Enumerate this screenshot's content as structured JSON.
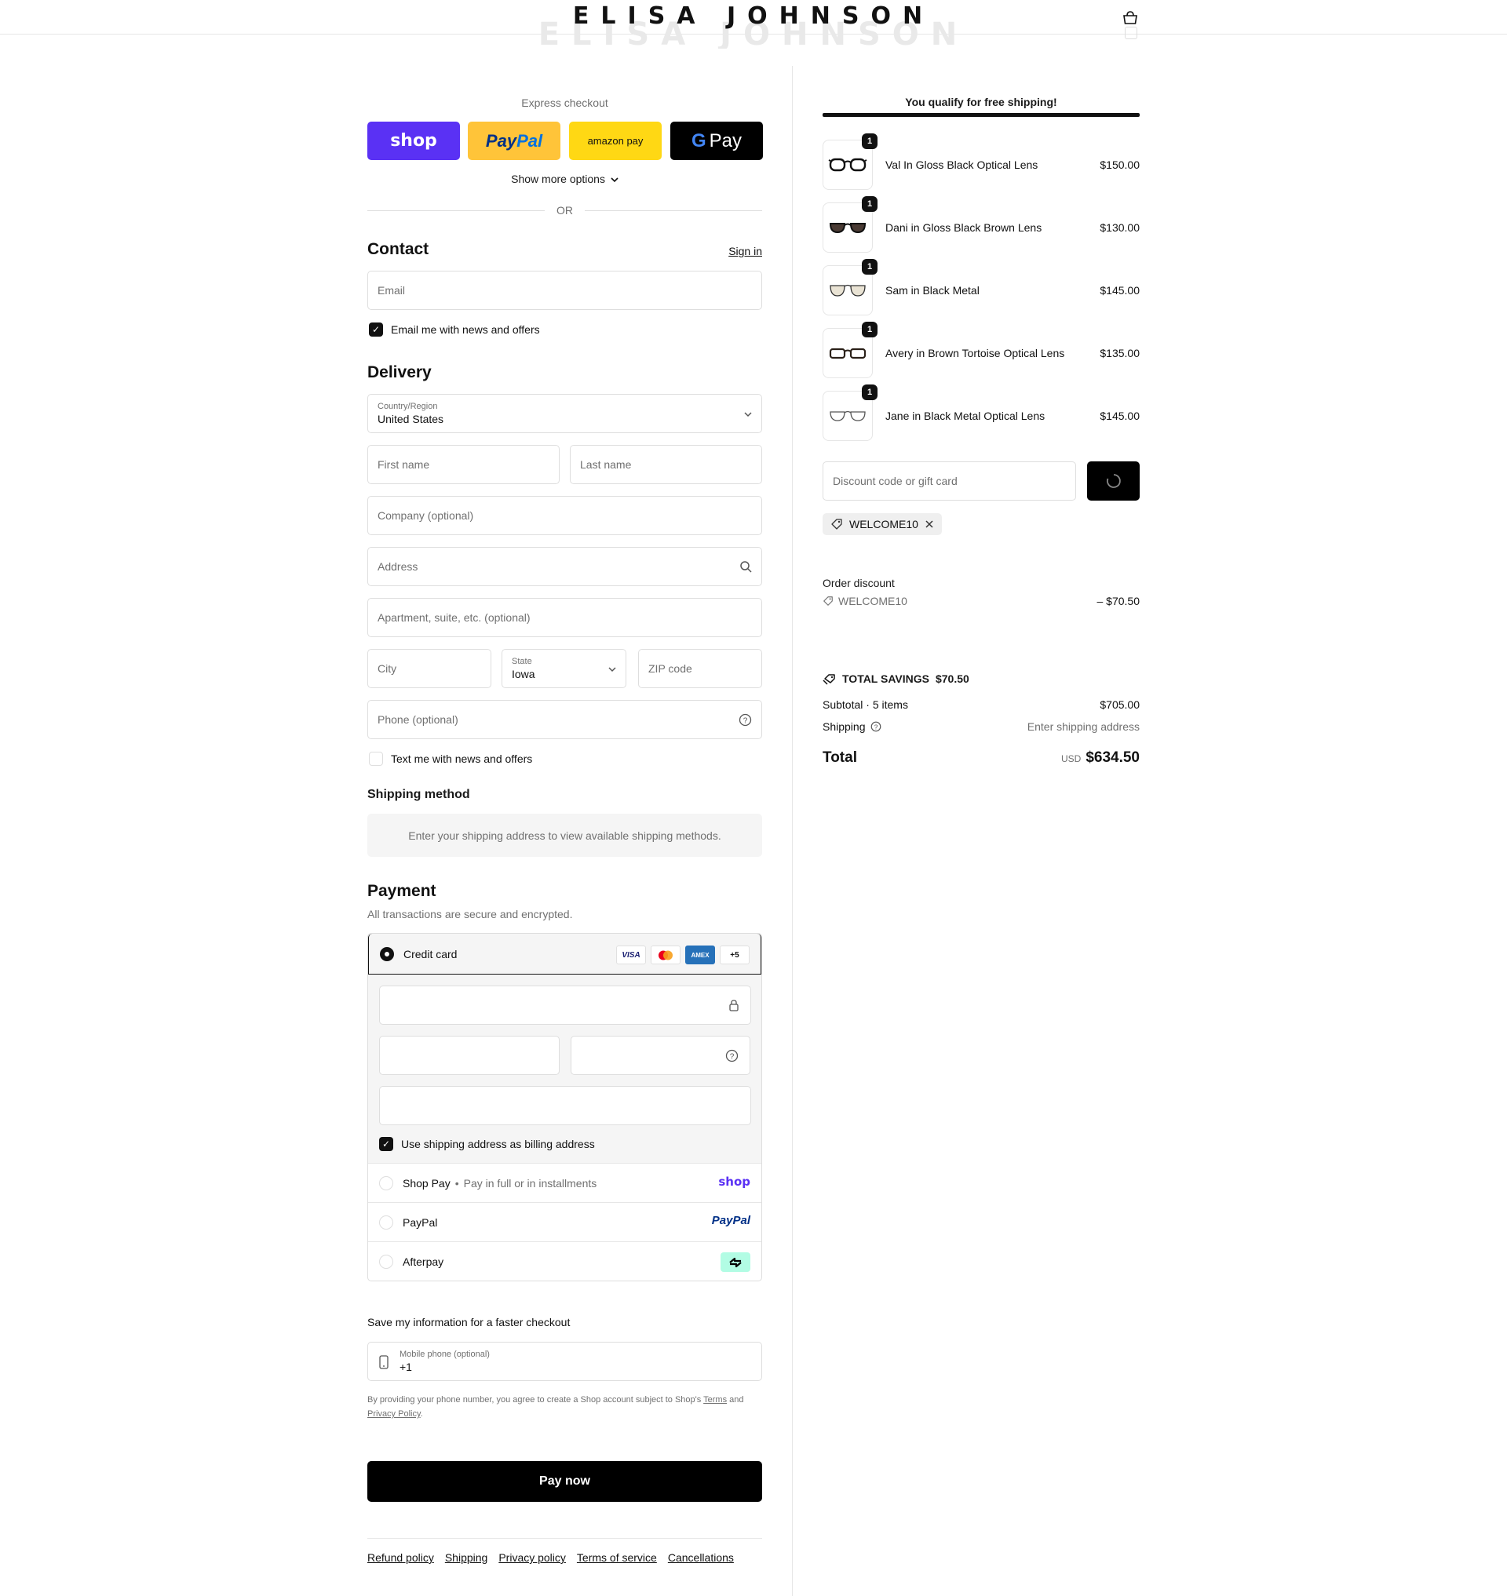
{
  "header": {
    "logo": "ELISA JOHNSON"
  },
  "express": {
    "label": "Express checkout",
    "shop_label": "shop",
    "paypal_pay": "Pay",
    "paypal_pal": "Pal",
    "amazon_label": "amazon pay",
    "gpay_label": "Pay",
    "more_options": "Show more options",
    "or": "OR"
  },
  "contact": {
    "title": "Contact",
    "signin": "Sign in",
    "email_placeholder": "Email",
    "newsletter_label": "Email me with news and offers",
    "newsletter_checked": true
  },
  "delivery": {
    "title": "Delivery",
    "country_label": "Country/Region",
    "country_value": "United States",
    "first_name": "First name",
    "last_name": "Last name",
    "company": "Company (optional)",
    "address": "Address",
    "apartment": "Apartment, suite, etc. (optional)",
    "city": "City",
    "state_label": "State",
    "state_value": "Iowa",
    "zip": "ZIP code",
    "phone": "Phone (optional)",
    "sms_label": "Text me with news and offers",
    "sms_checked": false
  },
  "shipping_method": {
    "title": "Shipping method",
    "message": "Enter your shipping address to view available shipping methods."
  },
  "payment": {
    "title": "Payment",
    "subtitle": "All transactions are secure and encrypted.",
    "credit_card_label": "Credit card",
    "card_badges": [
      "VISA",
      "MC",
      "AMEX",
      "+5"
    ],
    "billing_label": "Use shipping address as billing address",
    "shoppay_label": "Shop Pay",
    "shoppay_sub": "Pay in full or in installments",
    "shoppay_logo": "shop",
    "paypal_label": "PayPal",
    "paypal_logo": "PayPal",
    "afterpay_label": "Afterpay"
  },
  "save_info": {
    "title": "Save my information for a faster checkout",
    "mobile_label": "Mobile phone (optional)",
    "mobile_value": "+1",
    "legal_prefix": "By providing your phone number, you agree to create a Shop account subject to Shop's",
    "terms": "Terms",
    "legal_and": "and",
    "privacy": "Privacy Policy",
    "legal_end": "."
  },
  "pay_now": "Pay now",
  "footer": {
    "links": [
      "Refund policy",
      "Shipping",
      "Privacy policy",
      "Terms of service",
      "Cancellations"
    ]
  },
  "summary": {
    "free_shipping": "You qualify for free shipping!",
    "items": [
      {
        "name": "Val In Gloss Black Optical Lens",
        "price": "$150.00",
        "qty": "1"
      },
      {
        "name": "Dani in Gloss Black Brown Lens",
        "price": "$130.00",
        "qty": "1"
      },
      {
        "name": "Sam in Black Metal",
        "price": "$145.00",
        "qty": "1"
      },
      {
        "name": "Avery in Brown Tortoise Optical Lens",
        "price": "$135.00",
        "qty": "1"
      },
      {
        "name": "Jane in Black Metal Optical Lens",
        "price": "$145.00",
        "qty": "1"
      }
    ],
    "discount_placeholder": "Discount code or gift card",
    "applied_code": "WELCOME10",
    "order_discount_label": "Order discount",
    "order_discount_code": "WELCOME10",
    "order_discount_value": "– $70.50",
    "total_savings_label": "TOTAL SAVINGS",
    "total_savings_value": "$70.50",
    "subtotal_label": "Subtotal · 5 items",
    "subtotal_value": "$705.00",
    "shipping_label": "Shipping",
    "shipping_value": "Enter shipping address",
    "total_label": "Total",
    "currency": "USD",
    "total_value": "$634.50"
  }
}
